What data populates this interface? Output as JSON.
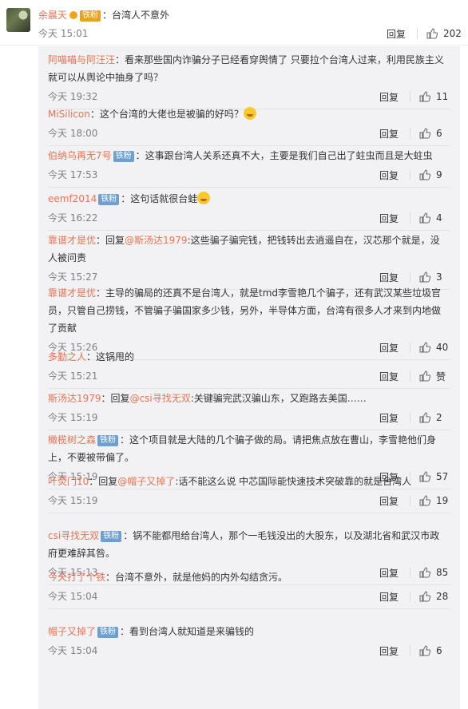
{
  "top_comment": {
    "user": "余晨天",
    "badge": "铁粉",
    "text": "：台湾人不意外",
    "time": "今天 15:01",
    "reply": "回复",
    "likes": "202"
  },
  "replies": [
    {
      "user": "阿喵喵与阿汪汪",
      "badge": "",
      "lines": [
        "：看来那些国内诈骗分子已经看穿舆情了 只要拉个台湾人过来，利用民族主义",
        "就可以从舆论中抽身了吗？"
      ],
      "time": "今天 19:32",
      "reply": "回复",
      "likes": "11"
    },
    {
      "user": "MiSilicon",
      "badge": "",
      "lines": [
        "：这个台湾的大佬也是被骗的好吗？"
      ],
      "emoji": "cry-laugh-emoji",
      "time": "今天 18:00",
      "reply": "回复",
      "likes": "6"
    },
    {
      "user": "伯纳乌再无7号",
      "badge": "铁粉",
      "lines": [
        "：这事跟台湾人关系还真不大，主要是我们自己出了蛀虫而且是大蛀虫"
      ],
      "time": "今天 17:53",
      "reply": "回复",
      "likes": "9"
    },
    {
      "user": "eemf2014",
      "badge": "铁粉",
      "lines": [
        "：这句话就很台蛙"
      ],
      "emoji": "laugh-emoji",
      "time": "今天 16:22",
      "reply": "回复",
      "likes": "4"
    },
    {
      "user": "靠谱才是优",
      "badge": "",
      "prefix": "：回复",
      "at": "@斯汤达1979",
      "lines": [
        ":这些骗子骗完钱，把钱转出去逍遥自在，汉芯那个就是，没",
        "人被问责"
      ],
      "time": "今天 15:27",
      "reply": "回复",
      "likes": "3"
    },
    {
      "user": "靠谱才是优",
      "badge": "",
      "lines": [
        "：主导的骗局的还真不是台湾人，就是tmd李雪艳几个骗子，还有武汉某些垃圾官",
        "员，只管自己捞钱，不管骗子骗国家多少钱，另外，半导体方面，台湾有很多人才来到内地做",
        "了贡献"
      ],
      "time": "今天 15:26",
      "reply": "回复",
      "likes": "40"
    },
    {
      "user": "多勤之人",
      "badge": "",
      "lines": [
        "：这锅甩的"
      ],
      "time": "今天 15:21",
      "reply": "回复",
      "likes": "赞"
    },
    {
      "user": "斯汤达1979",
      "badge": "",
      "prefix": "：回复",
      "at": "@csi寻找无双",
      ":": "",
      "lines": [
        ":关键骗完武汉骗山东，又跑路去美国……"
      ],
      "time": "今天 15:19",
      "reply": "回复",
      "likes": "2"
    },
    {
      "user": "橄榄树之森",
      "badge": "铁粉",
      "lines": [
        "：这个项目就是大陆的几个骗子做的局。请把焦点放在曹山，李雪艳他们身",
        "上，不要被带偏了。"
      ],
      "time": "今天 15:19",
      "reply": "回复",
      "likes": "57"
    },
    {
      "user": "叶荧门10",
      "badge": "",
      "prefix": "：回复",
      "at": "@帽子又掉了",
      "lines": [
        ":话不能这么说 中芯国际能快速技术突破靠的就是台湾人"
      ],
      "time": "今天 15:19",
      "reply": "回复",
      "likes": "19"
    },
    {
      "user": "csi寻找无双",
      "badge": "铁粉",
      "lines": [
        "：锅不能都甩给台湾人，那个一毛钱没出的大股东，以及湖北省和武汉市政",
        "府更难辞其咎。"
      ],
      "time": "今天 15:13",
      "reply": "回复",
      "likes": "85"
    },
    {
      "user": "今天打了个铁",
      "badge": "",
      "lines": [
        "：台湾不意外，就是他妈的内外勾结贪污。"
      ],
      "time": "今天 15:04",
      "reply": "回复",
      "likes": "28"
    },
    {
      "user": "帽子又掉了",
      "badge": "铁粉",
      "lines": [
        "：看到台湾人就知道是来骗钱的"
      ],
      "time": "今天 15:04",
      "reply": "回复",
      "likes": "6"
    }
  ]
}
